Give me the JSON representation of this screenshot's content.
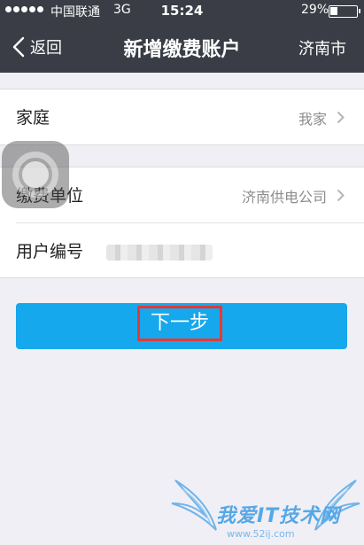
{
  "status_bar": {
    "carrier": "中国联通",
    "network": "3G",
    "time": "15:24",
    "battery": "29%",
    "battery_level": 0.29
  },
  "nav": {
    "back_label": "返回",
    "title": "新增缴费账户",
    "city": "济南市"
  },
  "group1": {
    "label": "家庭",
    "value": "我家"
  },
  "group2": {
    "unit_label": "缴费单位",
    "unit_value": "济南供电公司",
    "user_no_label": "用户编号"
  },
  "next_button": {
    "label": "下一步"
  },
  "watermark": {
    "text": "我爱IT技术网",
    "url": "www.52ij.com"
  },
  "colors": {
    "nav_bg": "#3a3d45",
    "button": "#16a8ec",
    "highlight": "#e53935"
  }
}
